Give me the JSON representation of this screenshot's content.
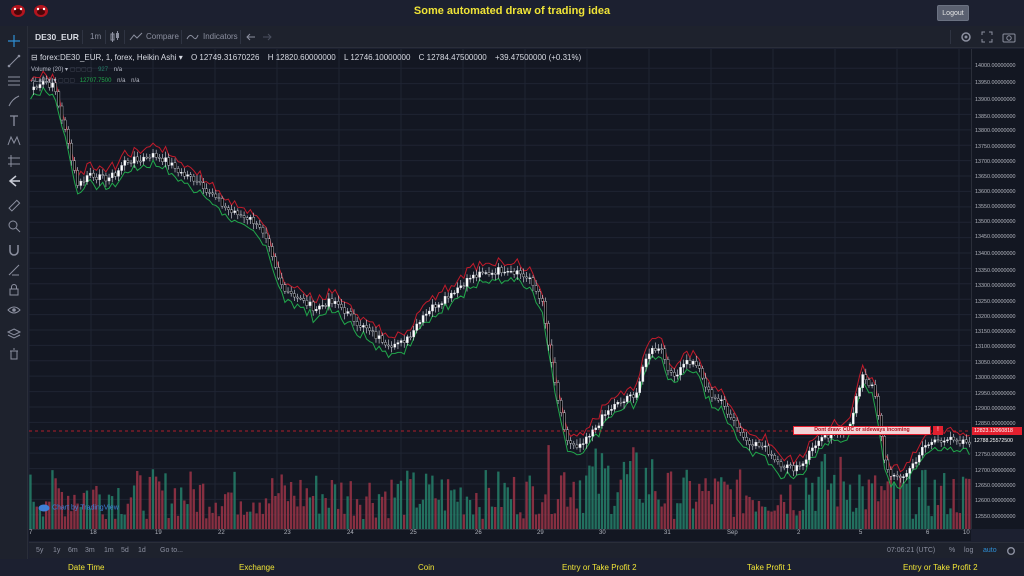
{
  "page": {
    "title": "Some automated draw of trading idea",
    "logout_label": "Logout"
  },
  "toolbar": {
    "symbol": "DE30_EUR",
    "interval": "1m",
    "compare_label": "Compare",
    "indicators_label": "Indicators"
  },
  "legend": {
    "main": "forex:DE30_EUR, 1, forex, Heikin Ashi",
    "open": "O 12749.31670226",
    "high": "H 12820.60000000",
    "low": "L 12746.10000000",
    "close": "C 12784.47500000",
    "change": "+39.47500000 (+0.31%)",
    "volume_label": "Volume (20)",
    "volume_value": "927",
    "volume_na": "n/a",
    "ind_label": "ALaPoil",
    "ind_value": "12707.7500",
    "ind_na1": "n/a",
    "ind_na2": "n/a"
  },
  "watermark": "Chart by TradingView",
  "annotation": {
    "text": "Dont draw: CUC or sideways incoming",
    "button": "!"
  },
  "price_axis": {
    "labels": [
      "14000.00000000",
      "13950.00000000",
      "13900.00000000",
      "13850.00000000",
      "13800.00000000",
      "13750.00000000",
      "13700.00000000",
      "13650.00000000",
      "13600.00000000",
      "13550.00000000",
      "13500.00000000",
      "13450.00000000",
      "13400.00000000",
      "13350.00000000",
      "13300.00000000",
      "13250.00000000",
      "13200.00000000",
      "13150.00000000",
      "13100.00000000",
      "13050.00000000",
      "13000.00000000",
      "12950.00000000",
      "12900.00000000",
      "12850.00000000",
      "12750.00000000",
      "12700.00000000",
      "12650.00000000",
      "12600.00000000",
      "12550.00000000"
    ],
    "current_price": "12823.13060818",
    "last_price": "12788.25572500"
  },
  "time_axis": {
    "labels": [
      "7",
      "18",
      "19",
      "22",
      "23",
      "24",
      "25",
      "26",
      "29",
      "30",
      "31",
      "Sep",
      "2",
      "5",
      "6",
      "10"
    ]
  },
  "bottom_bar": {
    "ranges": [
      "5y",
      "1y",
      "6m",
      "3m",
      "1m",
      "5d",
      "1d"
    ],
    "goto": "Go to...",
    "clock": "07:06:21 (UTC)",
    "percent": "%",
    "log": "log",
    "auto": "auto"
  },
  "footer": {
    "columns": [
      "Date Time",
      "Exchange",
      "Coin",
      "Entry or Take Profit 2",
      "Take Profit 1",
      "Entry or Take Profit 2"
    ]
  },
  "colors": {
    "bg": "#131722",
    "up_candle": "#ffffff",
    "down_candle": "#000000",
    "ema_red": "#c21b2b",
    "ema_green": "#21a84b",
    "volume_up": "#26806a",
    "volume_down": "#9c3446",
    "title_yellow": "#f0e437"
  },
  "chart_data": {
    "type": "line",
    "y_range": [
      12520,
      14030
    ],
    "series": [
      {
        "values": [
          13930,
          13960,
          13940,
          13780,
          13620,
          13660,
          13640,
          13650,
          13700,
          13700,
          13720,
          13710,
          13680,
          13650,
          13640,
          13600,
          13560,
          13530,
          13520,
          13500,
          13420,
          13300,
          13270,
          13240,
          13220,
          13240,
          13230,
          13190,
          13160,
          13130,
          13110,
          13100,
          13140,
          13200,
          13230,
          13260,
          13290,
          13320,
          13330,
          13340,
          13350,
          13340,
          13310,
          13250,
          13000,
          12800,
          12760,
          12800,
          12860,
          12900,
          12920,
          12950,
          13080,
          13100,
          12990,
          13050,
          13040,
          12950,
          12920,
          12870,
          12800,
          12780,
          12760,
          12720,
          12700,
          12720,
          12780,
          12800,
          12820,
          12840,
          13010,
          12950,
          12700,
          12660,
          12700,
          12760,
          12790,
          12800,
          12780,
          12790
        ]
      }
    ]
  }
}
